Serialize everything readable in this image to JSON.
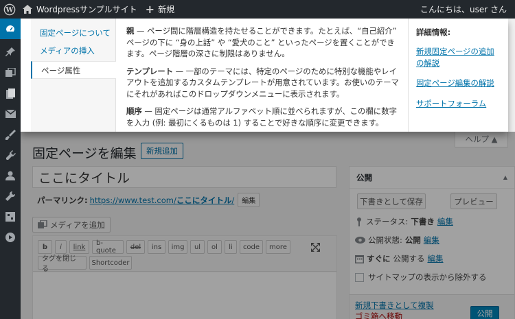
{
  "adminbar": {
    "site_name": "Wordpressサンプルサイト",
    "new_label": "新規",
    "greeting": "こんにちは、user さん"
  },
  "help": {
    "tabs": [
      {
        "label": "固定ページについて"
      },
      {
        "label": "メディアの挿入"
      },
      {
        "label": "ページ属性"
      }
    ],
    "paragraphs": [
      {
        "term": "親",
        "text": " — ページ間に階層構造を持たせることができます。たとえば、“自己紹介” ページの下に “身の上話” や “愛犬のこと” といったページを置くことができます。ページ階層の深さに制限はありません。"
      },
      {
        "term": "テンプレート",
        "text": " — 一部のテーマには、特定のページのために特別な機能やレイアウトを追加するカスタムテンプレートが用意されています。お使いのテーマにそれがあればこのドロップダウンメニューに表示されます。"
      },
      {
        "term": "順序",
        "text": " — 固定ページは通常アルファベット順に並べられますが、この欄に数字を入力 (例: 最初にくるものは 1) することで好きな順序に変更できます。"
      }
    ],
    "side_heading": "詳細情報:",
    "side_links": [
      {
        "label": "新規固定ページの追加の解説"
      },
      {
        "label": "固定ページ編集の解説"
      },
      {
        "label": "サポートフォーラム"
      }
    ],
    "help_button": "ヘルプ ▲"
  },
  "editor": {
    "page_title": "固定ページを編集",
    "add_new": "新規追加",
    "title_value": "ここにタイトル",
    "permalink_label": "パーマリンク:",
    "permalink_base": "https://www.test.com/",
    "permalink_slug": "ここにタイトル",
    "permalink_trail": "/",
    "edit_label": "編集",
    "add_media": "メディアを追加",
    "quicktags_row1": [
      "b",
      "i",
      "link",
      "b-quote",
      "del",
      "ins",
      "img",
      "ul",
      "ol",
      "li",
      "code",
      "more"
    ],
    "quicktags_row2": [
      "タグを閉じる",
      "Shortcoder"
    ]
  },
  "publish": {
    "heading": "公開",
    "save_draft": "下書きとして保存",
    "preview": "プレビュー",
    "status_label": "ステータス:",
    "status_value": "下書き",
    "visibility_label": "公開状態:",
    "visibility_value": "公開",
    "schedule_label": "すぐに",
    "schedule_text": "公開する",
    "edit_link": "編集",
    "sitemap_exclude": "サイトマップの表示から除外する",
    "copy_draft": "新規下書きとして複製",
    "trash": "ゴミ箱へ移動",
    "publish_button": "公開",
    "link_color": "#0073aa",
    "trash_color": "#a00"
  }
}
